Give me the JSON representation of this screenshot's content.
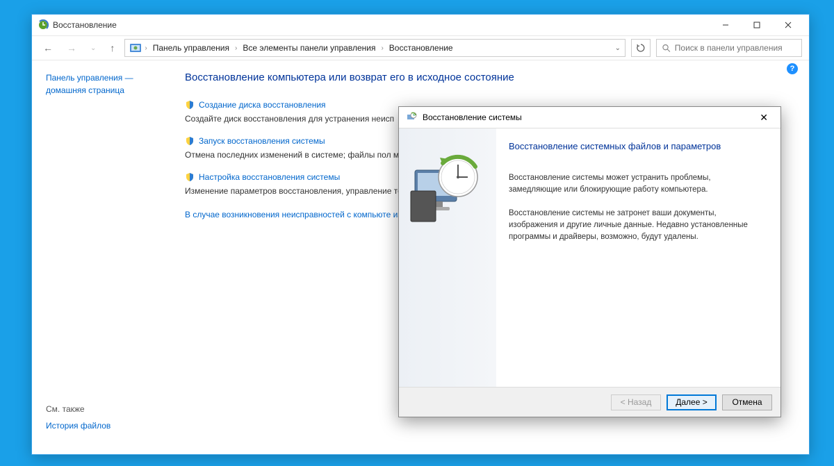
{
  "window": {
    "title": "Восстановление",
    "controls_min": "–",
    "controls_max": "▢",
    "controls_close": "✕"
  },
  "toolbar": {
    "breadcrumb": [
      "Панель управления",
      "Все элементы панели управления",
      "Восстановление"
    ],
    "search_placeholder": "Поиск в панели управления"
  },
  "sidebar": {
    "home_line1": "Панель управления —",
    "home_line2": "домашняя страница",
    "see_also": "См. также",
    "file_history": "История файлов"
  },
  "main": {
    "heading": "Восстановление компьютера или возврат его в исходное состояние",
    "items": [
      {
        "link": "Создание диска восстановления",
        "desc": "Создайте диск восстановления для устранения неисп"
      },
      {
        "link": "Запуск восстановления системы",
        "desc": "Отмена последних изменений в системе; файлы пол музыка, остаются без изменений."
      },
      {
        "link": "Настройка восстановления системы",
        "desc": "Изменение параметров восстановления, управление точек восстановления."
      }
    ],
    "note": "В случае возникновения неисправностей с компьюте изменить их."
  },
  "dialog": {
    "title": "Восстановление системы",
    "heading": "Восстановление системных файлов и параметров",
    "para1": "Восстановление системы может устранить проблемы, замедляющие или блокирующие работу компьютера.",
    "para2": "Восстановление системы не затронет ваши документы, изображения и другие личные данные. Недавно установленные программы и драйверы, возможно, будут удалены.",
    "btn_back": "< Назад",
    "btn_next": "Далее >",
    "btn_cancel": "Отмена"
  }
}
